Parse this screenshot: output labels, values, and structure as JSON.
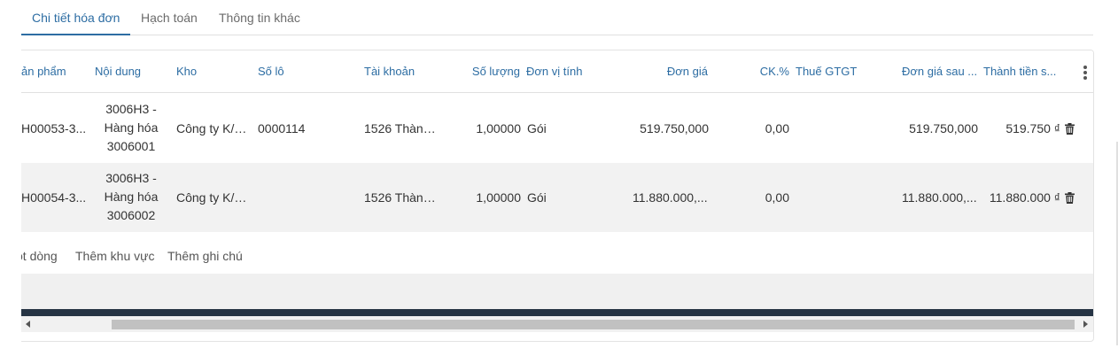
{
  "tabs": [
    {
      "label": "Chi tiết hóa đơn",
      "active": true
    },
    {
      "label": "Hạch toán",
      "active": false
    },
    {
      "label": "Thông tin khác",
      "active": false
    }
  ],
  "columns": {
    "product": "ản phẩm",
    "description": "Nội dung",
    "warehouse": "Kho",
    "lot": "Số lô",
    "account": "Tài khoản",
    "quantity": "Số lượng",
    "unit": "Đơn vị tính",
    "unit_price": "Đơn giá",
    "discount": "CK.%",
    "vat": "Thuế GTGT",
    "price_after": "Đơn giá sau ...",
    "amount": "Thành tiền s..."
  },
  "rows": [
    {
      "product": "H00053-3...",
      "description": "3006H3 - Hàng hóa 3006001",
      "warehouse": "Công ty K/K...",
      "lot": "0000114",
      "account": "1526 Thành...",
      "quantity": "1,00000",
      "unit": "Gói",
      "unit_price": "519.750,000",
      "discount": "0,00",
      "vat": "",
      "price_after": "519.750,000",
      "amount": "519.750 ₫"
    },
    {
      "product": "H00054-3...",
      "description": "3006H3 - Hàng hóa 3006002",
      "warehouse": "Công ty K/K...",
      "lot": "",
      "account": "1526 Thành...",
      "quantity": "1,00000",
      "unit": "Gói",
      "unit_price": "11.880.000,...",
      "discount": "0,00",
      "vat": "",
      "price_after": "11.880.000,...",
      "amount": "11.880.000 ₫"
    }
  ],
  "actions": {
    "add_row": "ột dòng",
    "add_section": "Thêm khu vực",
    "add_note": "Thêm ghi chú"
  },
  "colors": {
    "accent": "#2d6da3",
    "header_text": "#2d6da3",
    "dark_bar": "#263444",
    "stripe": "#f2f2f2"
  },
  "icons": {
    "more": "more-vertical-icon",
    "delete": "trash-icon",
    "scroll_left": "arrow-left-icon",
    "scroll_right": "arrow-right-icon"
  }
}
